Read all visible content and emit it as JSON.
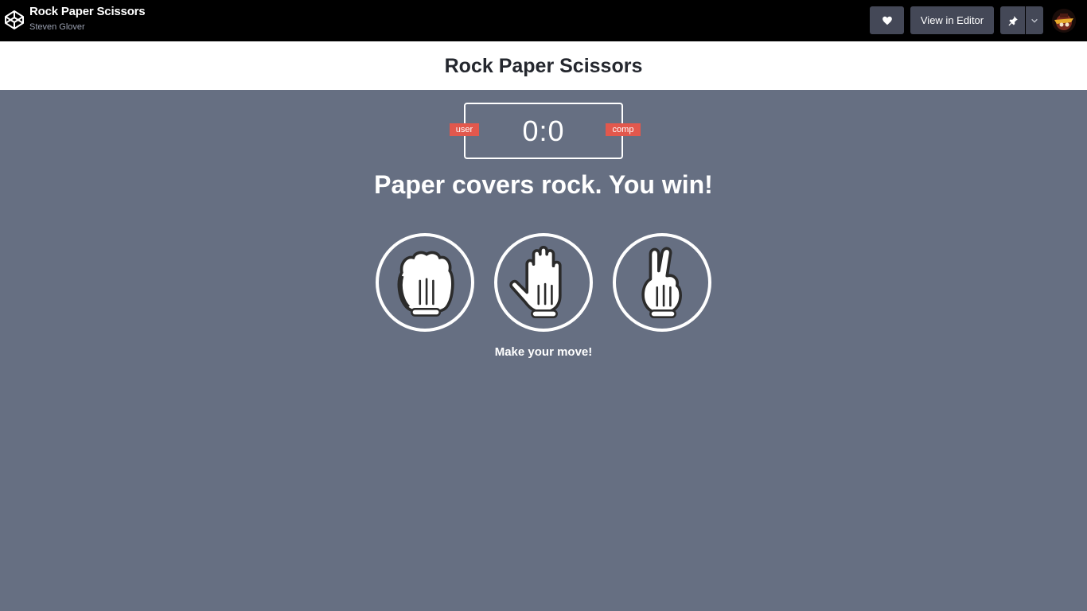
{
  "topbar": {
    "pen_title": "Rock Paper Scissors",
    "author": "Steven Glover",
    "view_in_editor_label": "View in Editor",
    "icons": [
      "codepen-logo-icon",
      "heart-icon",
      "pin-icon",
      "chevron-down-icon",
      "avatar"
    ]
  },
  "game": {
    "title": "Rock Paper Scissors",
    "score": "0:0",
    "user_label": "user",
    "comp_label": "comp",
    "result": "Paper covers rock. You win!",
    "prompt": "Make your move!",
    "choices": [
      "rock",
      "paper",
      "scissors"
    ]
  },
  "colors": {
    "topbar_bg": "#000000",
    "button_bg": "#444857",
    "page_bg": "#666f82",
    "badge_red": "#e2584d",
    "title_strip_bg": "#ffffff"
  }
}
